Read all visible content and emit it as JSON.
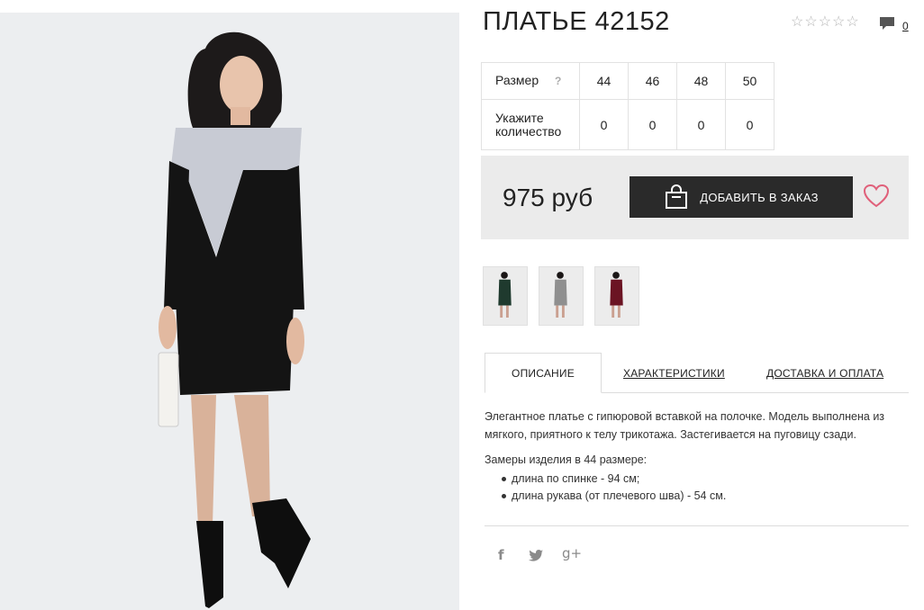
{
  "product": {
    "title": "ПЛАТЬЕ 42152",
    "rating_stars": [
      "☆",
      "☆",
      "☆",
      "☆",
      "☆"
    ],
    "comments_count": "0",
    "price": "975 руб",
    "add_to_order": "ДОБАВИТЬ В ЗАКАЗ"
  },
  "size_table": {
    "size_label": "Размер",
    "help": "?",
    "sizes": [
      "44",
      "46",
      "48",
      "50"
    ],
    "qty_label": "Укажите количество",
    "quantities": [
      "0",
      "0",
      "0",
      "0"
    ]
  },
  "thumbnails": [
    {
      "name": "green",
      "color": "#1f3a2e"
    },
    {
      "name": "grey",
      "color": "#8f8f8f"
    },
    {
      "name": "burgundy",
      "color": "#6b1423"
    }
  ],
  "tabs": {
    "description": "ОПИСАНИЕ",
    "characteristics": "ХАРАКТЕРИСТИКИ",
    "delivery": "ДОСТАВКА И ОПЛАТА"
  },
  "description": {
    "text": "Элегантное платье с гипюровой вставкой на полочке. Модель выполнена из мягкого, приятного к телу трикотажа. Застегивается на пуговицу сзади.",
    "measures_title": "Замеры изделия в 44 размере:",
    "measures": [
      "длина по спинке - 94 см;",
      "длина рукава (от плечевого шва) - 54 см."
    ]
  },
  "social": {
    "facebook": "f",
    "twitter": "twitter-icon",
    "googleplus": "g+"
  },
  "colors": {
    "button_bg": "#2a2a2a",
    "heart": "#e0607a",
    "price_bar": "#ebebeb"
  }
}
